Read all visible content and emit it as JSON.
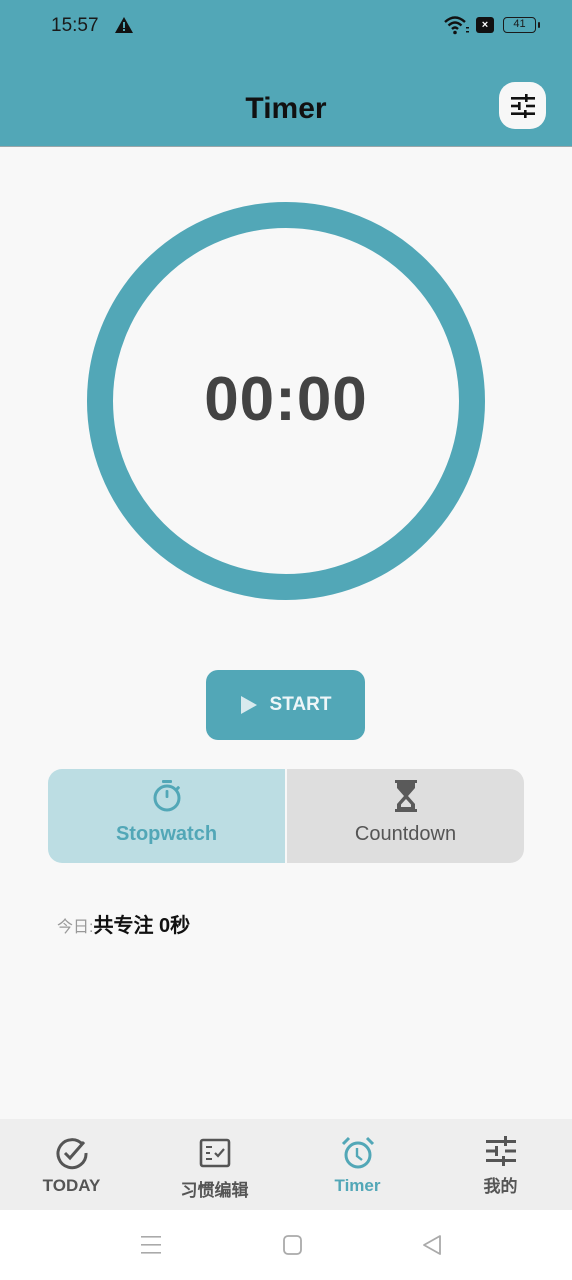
{
  "status_bar": {
    "time": "15:57",
    "sim_badge": "×",
    "battery_level": "41",
    "icons": [
      "warning-icon",
      "wifi-icon",
      "sim-off-icon",
      "battery-icon"
    ]
  },
  "app_bar": {
    "title": "Timer",
    "settings_icon": "sliders-icon"
  },
  "timer": {
    "display": "00:00",
    "ring_progress": 1.0,
    "ring_color": "#52a7b7"
  },
  "start_button": {
    "label": "START",
    "icon": "play-icon"
  },
  "mode_toggle": {
    "selected": "stopwatch",
    "options": [
      {
        "id": "stopwatch",
        "label": "Stopwatch",
        "icon": "stopwatch-icon"
      },
      {
        "id": "countdown",
        "label": "Countdown",
        "icon": "hourglass-icon"
      }
    ]
  },
  "today_stats": {
    "prefix": "今日:",
    "value": "共专注 0秒"
  },
  "bottom_nav": {
    "active": "timer",
    "items": [
      {
        "id": "today",
        "label": "TODAY",
        "icon": "check-circle-icon"
      },
      {
        "id": "habit-edit",
        "label": "习惯编辑",
        "icon": "checklist-icon"
      },
      {
        "id": "timer",
        "label": "Timer",
        "icon": "alarm-clock-icon"
      },
      {
        "id": "mine",
        "label": "我的",
        "icon": "sliders-icon"
      }
    ]
  },
  "system_nav": {
    "buttons": [
      "menu-icon",
      "home-icon",
      "back-icon"
    ]
  },
  "colors": {
    "accent": "#52a7b7",
    "accent_light": "#bcdde3",
    "background": "#f8f8f8",
    "nav_background": "#eeeeee",
    "timer_text": "#434343"
  }
}
